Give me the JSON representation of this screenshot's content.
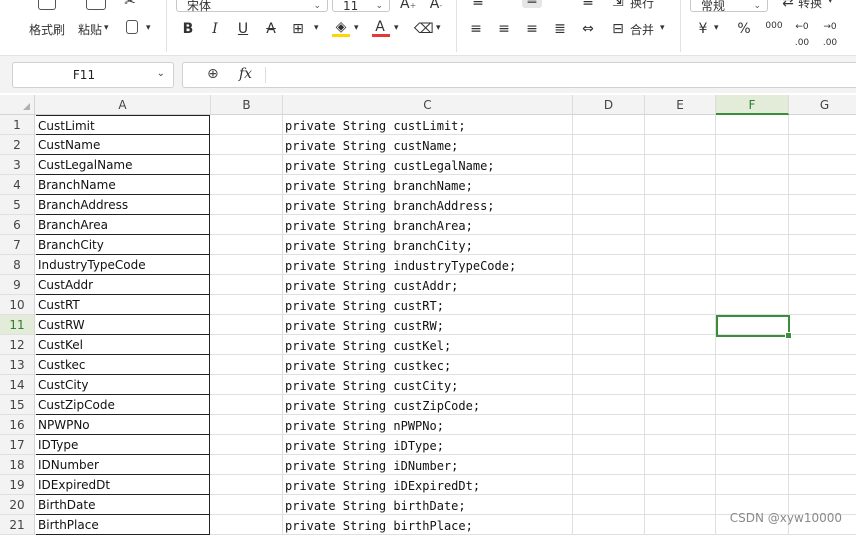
{
  "ribbon": {
    "format_painter": "格式刷",
    "paste": "粘贴",
    "font_name": "宋体",
    "font_size": "11",
    "wrap_text": "换行",
    "number_format": "常规",
    "convert": "转换",
    "merge": "合并",
    "currency_symbol": "¥",
    "percent_symbol": "%",
    "thousands_symbol": "000",
    "bold": "B",
    "italic": "I",
    "underline": "U",
    "strike": "A",
    "font_color": "A",
    "font_color_hex": "#e53935",
    "fill_color_hex": "#ffd600"
  },
  "formula_bar": {
    "cell_ref": "F11",
    "fx_label": "fx",
    "formula": ""
  },
  "columns": [
    "A",
    "B",
    "C",
    "D",
    "E",
    "F",
    "G"
  ],
  "selected_column": "F",
  "selected_row": "11",
  "rows": [
    {
      "num": "1",
      "a": "CustLimit",
      "c": "private String custLimit;"
    },
    {
      "num": "2",
      "a": "CustName",
      "c": "private String custName;"
    },
    {
      "num": "3",
      "a": "CustLegalName",
      "c": "private String custLegalName;"
    },
    {
      "num": "4",
      "a": "BranchName",
      "c": "private String branchName;"
    },
    {
      "num": "5",
      "a": "BranchAddress",
      "c": "private String branchAddress;"
    },
    {
      "num": "6",
      "a": "BranchArea",
      "c": "private String branchArea;"
    },
    {
      "num": "7",
      "a": "BranchCity",
      "c": "private String branchCity;"
    },
    {
      "num": "8",
      "a": "IndustryTypeCode",
      "c": "private String industryTypeCode;"
    },
    {
      "num": "9",
      "a": "CustAddr",
      "c": "private String custAddr;"
    },
    {
      "num": "10",
      "a": "CustRT",
      "c": "private String custRT;"
    },
    {
      "num": "11",
      "a": "CustRW",
      "c": "private String custRW;"
    },
    {
      "num": "12",
      "a": "CustKel",
      "c": "private String custKel;"
    },
    {
      "num": "13",
      "a": "Custkec",
      "c": "private String custkec;"
    },
    {
      "num": "14",
      "a": "CustCity",
      "c": "private String custCity;"
    },
    {
      "num": "15",
      "a": "CustZipCode",
      "c": "private String custZipCode;"
    },
    {
      "num": "16",
      "a": "NPWPNo",
      "c": "private String nPWPNo;"
    },
    {
      "num": "17",
      "a": "IDType",
      "c": "private String iDType;"
    },
    {
      "num": "18",
      "a": "IDNumber",
      "c": "private String iDNumber;"
    },
    {
      "num": "19",
      "a": "IDExpiredDt",
      "c": "private String iDExpiredDt;"
    },
    {
      "num": "20",
      "a": "BirthDate",
      "c": "private String birthDate;"
    },
    {
      "num": "21",
      "a": "BirthPlace",
      "c": "private String birthPlace;"
    }
  ],
  "watermark": "CSDN @xyw10000",
  "colors": {
    "selection_green": "#3a8d3a",
    "header_bg": "#f3f3f3",
    "selected_header_bg": "#e2ecd8"
  }
}
